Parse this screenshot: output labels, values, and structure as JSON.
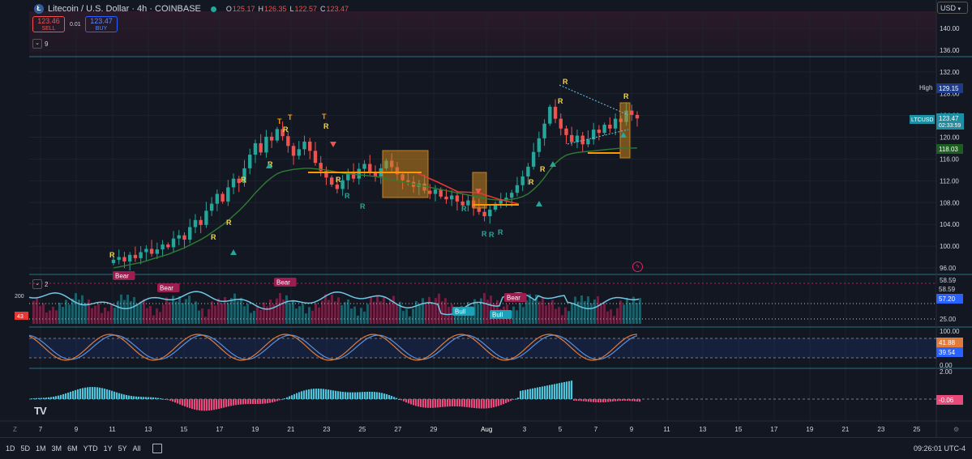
{
  "header": {
    "symbol_icon": "litecoin-icon",
    "title": "Litecoin / U.S. Dollar · 4h · COINBASE",
    "ohlc": [
      {
        "key": "O",
        "value": "125.17"
      },
      {
        "key": "H",
        "value": "126.35"
      },
      {
        "key": "L",
        "value": "122.57"
      },
      {
        "key": "C",
        "value": "123.47"
      }
    ]
  },
  "trade": {
    "sell_price": "123.46",
    "sell_label": "SELL",
    "spread": "0.01",
    "buy_price": "123.47",
    "buy_label": "BUY"
  },
  "currency": "USD",
  "panes": {
    "main_collapse": "9",
    "volume_collapse": "2"
  },
  "price_axis": {
    "main_ticks": [
      "140.00",
      "136.00",
      "132.00",
      "128.00",
      "124.00",
      "120.00",
      "116.00",
      "112.00",
      "108.00",
      "104.00",
      "100.00",
      "96.00"
    ],
    "high_label": "High",
    "high_value": "129.15",
    "symbol_tag": "LTCUSD",
    "last_price": "123.47",
    "countdown": "02:33:59",
    "ema_value": "118.03",
    "vol_ticks": [
      "58.59",
      "58.59",
      "57.20",
      "25.00"
    ],
    "vol_left_200": "200",
    "vol_left_43": "43",
    "stoch_ticks": [
      "100.00",
      "41.88",
      "39.54",
      "0.00"
    ],
    "macd_ticks": [
      "2.00",
      "-0.06"
    ]
  },
  "time_axis": [
    "7",
    "9",
    "11",
    "13",
    "15",
    "17",
    "19",
    "21",
    "23",
    "25",
    "27",
    "29",
    "Aug",
    "3",
    "5",
    "7",
    "9",
    "11",
    "13",
    "15",
    "17",
    "19",
    "21",
    "23",
    "25"
  ],
  "time_axis_left_mark": "Z",
  "signals": {
    "r": "R",
    "t": "T",
    "bear": "Bear",
    "bull": "Bull"
  },
  "ranges": [
    "1D",
    "5D",
    "1M",
    "3M",
    "6M",
    "YTD",
    "1Y",
    "5Y",
    "All"
  ],
  "clock": "09:26:01 UTC-4",
  "logo": "TV",
  "colors": {
    "up": "#26a69a",
    "down": "#ef5350",
    "ema": "#2e7d32",
    "signal_r": "#f0d44e",
    "signal_t": "#ff9800",
    "box": "#c8831d",
    "vwline": "#ff9800",
    "downtrend": "#e53935",
    "rsi_line": "#6fc7e6",
    "stoch_k": "#e07b39",
    "stoch_d": "#5b8fd8",
    "macd_up": "#4fc3d9",
    "macd_down": "#e84b7a",
    "bear_tag": "#9c1d4f",
    "bull_tag": "#1ba2b8",
    "accent": "#2962ff"
  },
  "chart_data": {
    "type": "candlestick",
    "ylim": [
      94,
      142
    ],
    "candles": [
      [
        115.4,
        "D"
      ],
      [
        114.6,
        "D"
      ]
    ],
    "close_series": [
      97.5,
      98,
      97.2,
      98.4,
      97.8,
      98.9,
      99.5,
      98.6,
      99.4,
      100.3,
      99.8,
      101.4,
      102,
      101.2,
      103.5,
      104.8,
      103.9,
      106.5,
      107.8,
      109.6,
      108.2,
      110.8,
      112.4,
      111.6,
      114.3,
      116.8,
      118.9,
      117.2,
      120.1,
      119.4,
      121.5,
      120.2,
      118.4,
      116.6,
      117.8,
      119.2,
      117.5,
      115.3,
      113.8,
      112.6,
      111.3,
      110.5,
      112.1,
      113.7,
      112.4,
      114.2,
      115.1,
      113.6,
      112.8,
      114.3,
      115.7,
      114.5,
      113.2,
      112.1,
      111.8,
      110.9,
      111.5,
      110.2,
      109.6,
      110.4,
      109.1,
      108.6,
      109.3,
      108.2,
      107.5,
      108.4,
      107.1,
      106.3,
      105.5,
      106.7,
      107.8,
      108.4,
      108.9,
      109.8,
      111.2,
      112.8,
      114.6,
      117.3,
      119.8,
      122.5,
      125.6,
      123.4,
      121.6,
      120.4,
      119.1,
      120.3,
      118.7,
      119.6,
      121.4,
      120.8,
      122.3,
      121.6,
      123.4,
      122.8,
      124.9,
      124.1,
      123.47
    ],
    "ema_series": [
      96,
      96.2,
      96.4,
      96.6,
      96.8,
      97,
      97.3,
      97.6,
      97.9,
      98.2,
      98.5,
      98.9,
      99.3,
      99.7,
      100.2,
      100.7,
      101.2,
      101.8,
      102.5,
      103.2,
      103.9,
      104.7,
      105.6,
      106.5,
      107.5,
      108.6,
      109.8,
      110.8,
      111.8,
      112.6,
      113.3,
      113.7,
      113.9,
      114.1,
      114.2,
      114.3,
      114.3,
      114.2,
      114.1,
      114,
      113.8,
      113.6,
      113.4,
      113.3,
      113.2,
      113.1,
      113,
      112.9,
      112.8,
      112.6,
      112.4,
      112.2,
      112,
      111.8,
      111.6,
      111.4,
      111.2,
      111,
      110.8,
      110.6,
      110.4,
      110.2,
      110,
      109.8,
      109.6,
      109.4,
      109.2,
      109,
      108.8,
      108.6,
      108.5,
      108.5,
      108.5,
      108.6,
      108.8,
      109.1,
      109.6,
      110.4,
      111.4,
      112.6,
      114,
      115.2,
      116.1,
      116.7,
      117,
      117.2,
      117.3,
      117.4,
      117.5,
      117.6,
      117.7,
      117.8,
      117.9,
      118,
      118,
      118.02,
      118.03
    ]
  }
}
